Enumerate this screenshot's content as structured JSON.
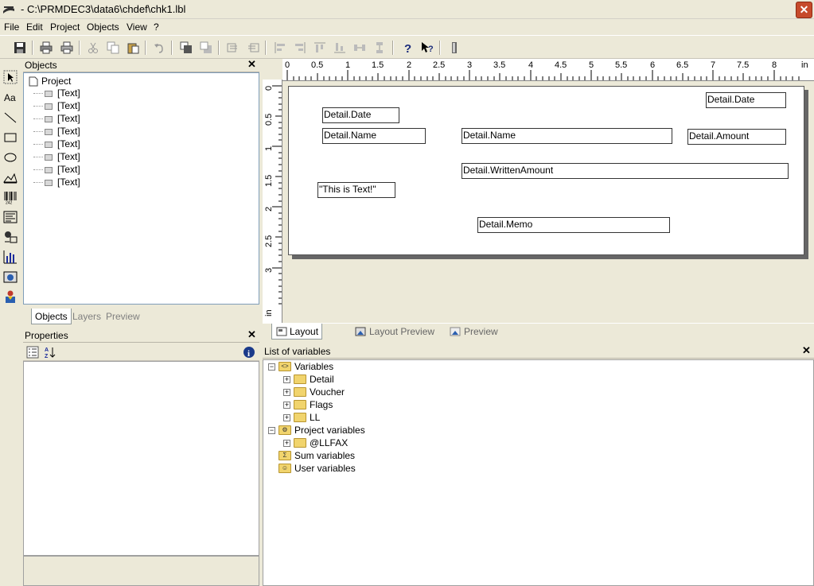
{
  "window": {
    "title": "- C:\\PRMDEC3\\data6\\chdef\\chk1.lbl"
  },
  "menu": [
    "File",
    "Edit",
    "Project",
    "Objects",
    "View",
    "?"
  ],
  "objects_panel": {
    "title": "Objects",
    "root": "Project",
    "items": [
      "[Text]",
      "[Text]",
      "[Text]",
      "[Text]",
      "[Text]",
      "[Text]",
      "[Text]",
      "[Text]"
    ],
    "tabs": [
      "Objects",
      "Layers",
      "Preview"
    ]
  },
  "properties_panel": {
    "title": "Properties"
  },
  "ruler": {
    "h_labels": [
      "0",
      "0.5",
      "1",
      "1.5",
      "2",
      "2.5",
      "3",
      "3.5",
      "4",
      "4.5",
      "5",
      "5.5",
      "6",
      "6.5",
      "7",
      "7.5",
      "8",
      "in"
    ],
    "v_labels": [
      "0",
      "0.5",
      "1",
      "1.5",
      "2",
      "2.5",
      "3",
      "in"
    ]
  },
  "fields": {
    "date_left": "Detail.Date",
    "date_right": "Detail.Date",
    "name_left": "Detail.Name",
    "name_mid": "Detail.Name",
    "amount": "Detail.Amount",
    "written_amount": "Detail.WrittenAmount",
    "literal_text": "\"This is Text!\"",
    "memo": "Detail.Memo"
  },
  "layout_tabs": [
    "Layout",
    "Layout Preview",
    "Preview"
  ],
  "variables_panel": {
    "title": "List of variables",
    "root": "Variables",
    "children": [
      "Detail",
      "Voucher",
      "Flags",
      "LL"
    ],
    "project_variables": "Project variables",
    "project_children": [
      "@LLFAX"
    ],
    "sum_variables": "Sum variables",
    "user_variables": "User variables"
  }
}
